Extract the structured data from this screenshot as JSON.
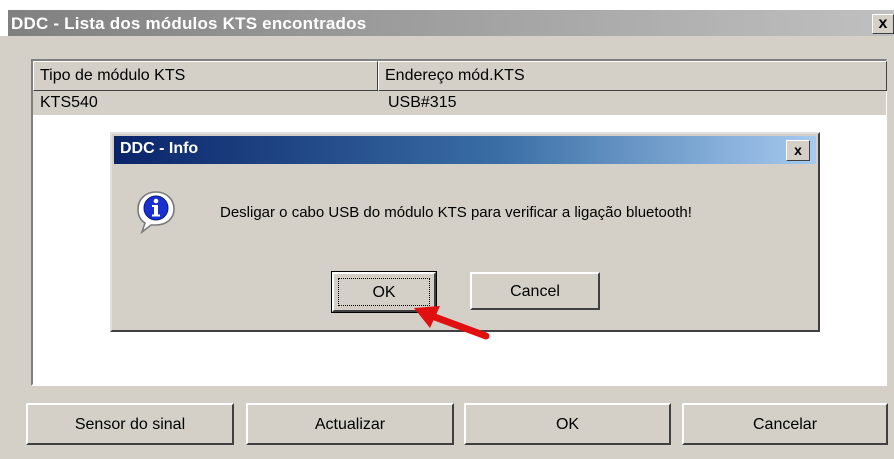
{
  "main_window": {
    "title": "DDC - Lista dos módulos KTS encontrados",
    "close_label": "x"
  },
  "list": {
    "columns": [
      "Tipo de módulo KTS",
      "Endereço mód.KTS"
    ],
    "rows": [
      [
        "KTS540",
        "USB#315"
      ]
    ]
  },
  "buttons": {
    "sensor": "Sensor do sinal",
    "refresh": "Actualizar",
    "ok": "OK",
    "cancel": "Cancelar"
  },
  "dialog": {
    "title": "DDC - Info",
    "close_label": "x",
    "message": "Desligar o cabo USB do módulo KTS para verificar a ligação bluetooth!",
    "ok_label": "OK",
    "cancel_label": "Cancel",
    "icon": "info-icon"
  },
  "colors": {
    "dialog_title_start": "#0a246a",
    "dialog_title_end": "#a6caf0",
    "arrow": "#e01010",
    "window_face": "#d4d0c8"
  }
}
